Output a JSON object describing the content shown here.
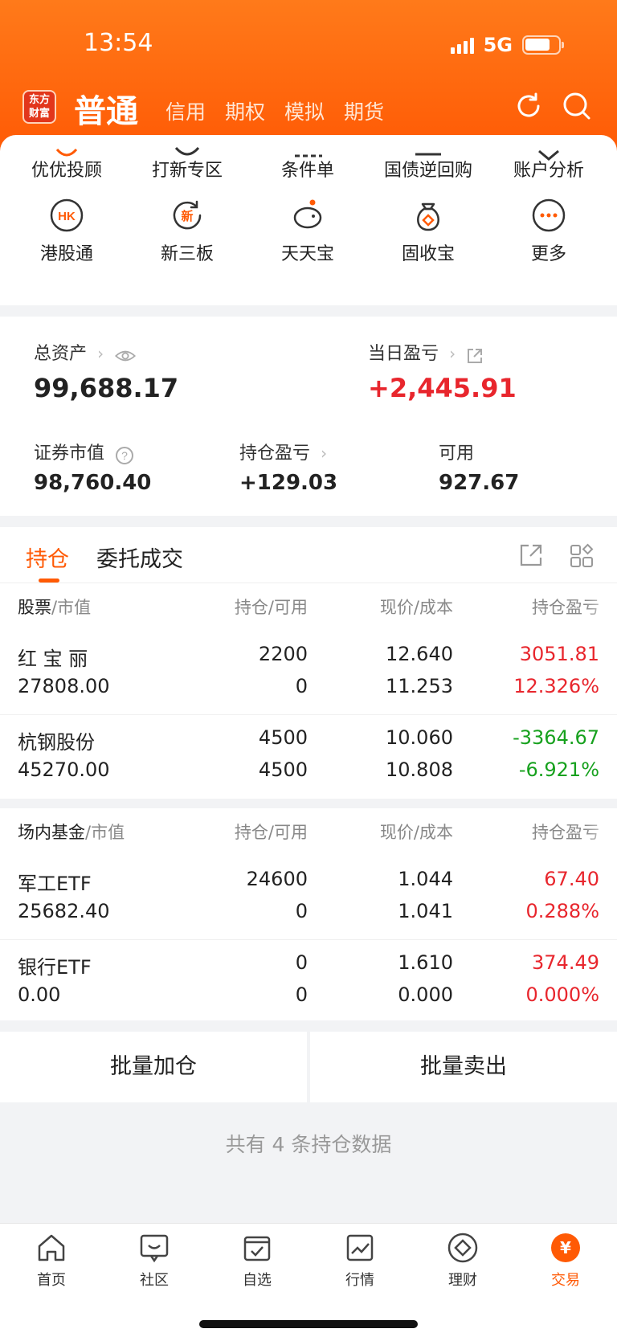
{
  "status_bar": {
    "time": "13:54",
    "network": "5G"
  },
  "header": {
    "logo_text": "东方财富",
    "main_tab": "普通",
    "tabs": [
      "信用",
      "期权",
      "模拟",
      "期货"
    ],
    "icons": [
      "refresh-icon",
      "search-icon"
    ]
  },
  "quick_menu": {
    "row1": [
      {
        "label": "优优投顾"
      },
      {
        "label": "打新专区"
      },
      {
        "label": "条件单"
      },
      {
        "label": "国债逆回购"
      },
      {
        "label": "账户分析"
      }
    ],
    "row2": [
      {
        "label": "港股通",
        "icon_text": "HK"
      },
      {
        "label": "新三板",
        "icon_text": "新"
      },
      {
        "label": "天天宝"
      },
      {
        "label": "固收宝"
      },
      {
        "label": "更多"
      }
    ]
  },
  "assets": {
    "total_label": "总资产",
    "total_value": "99,688.17",
    "daily_pl_label": "当日盈亏",
    "daily_pl_value": "+2,445.91",
    "market_value_label": "证券市值",
    "market_value": "98,760.40",
    "position_pl_label": "持仓盈亏",
    "position_pl_value": "+129.03",
    "available_label": "可用",
    "available_value": "927.67"
  },
  "positions": {
    "tab_active": "持仓",
    "tab_other": "委托成交",
    "stock_header": {
      "c1a": "股票",
      "c1b": "/市值",
      "c2": "持仓/可用",
      "c3": "现价/成本",
      "c4": "持仓盈亏"
    },
    "stocks": [
      {
        "name": "红 宝 丽",
        "market_value": "27808.00",
        "holding": "2200",
        "available": "0",
        "price": "12.640",
        "cost": "11.253",
        "pl": "3051.81",
        "pl_pct": "12.326%",
        "trend": "up"
      },
      {
        "name": "杭钢股份",
        "market_value": "45270.00",
        "holding": "4500",
        "available": "4500",
        "price": "10.060",
        "cost": "10.808",
        "pl": "-3364.67",
        "pl_pct": "-6.921%",
        "trend": "down"
      }
    ],
    "fund_header": {
      "c1a": "场内基金",
      "c1b": "/市值",
      "c2": "持仓/可用",
      "c3": "现价/成本",
      "c4": "持仓盈亏"
    },
    "funds": [
      {
        "name": "军工ETF",
        "market_value": "25682.40",
        "holding": "24600",
        "available": "0",
        "price": "1.044",
        "cost": "1.041",
        "pl": "67.40",
        "pl_pct": "0.288%",
        "trend": "up"
      },
      {
        "name": "银行ETF",
        "market_value": "0.00",
        "holding": "0",
        "available": "0",
        "price": "1.610",
        "cost": "0.000",
        "pl": "374.49",
        "pl_pct": "0.000%",
        "trend": "up"
      }
    ]
  },
  "actions": {
    "add": "批量加仓",
    "sell": "批量卖出"
  },
  "summary": "共有 4 条持仓数据",
  "bottom_nav": [
    {
      "label": "首页"
    },
    {
      "label": "社区"
    },
    {
      "label": "自选"
    },
    {
      "label": "行情"
    },
    {
      "label": "理财"
    },
    {
      "label": "交易",
      "active": true,
      "icon_text": "¥"
    }
  ],
  "colors": {
    "brand": "#ff5a05",
    "up": "#e8262d",
    "down": "#17a11e"
  }
}
